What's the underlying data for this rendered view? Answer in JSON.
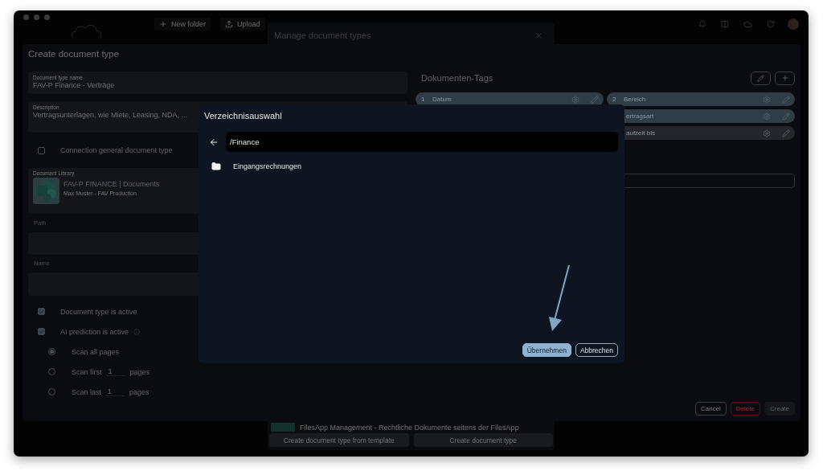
{
  "window": {
    "toolbar": [
      {
        "kind": "plus",
        "label": "New folder"
      },
      {
        "kind": "upload",
        "label": "Upload"
      }
    ]
  },
  "manage_modal": {
    "title": "Manage document types",
    "list_item": "FilesApp Management - Rechtliche Dokumente seitens der FilesApp",
    "buttons": [
      "Create document type from template",
      "Create document type"
    ]
  },
  "create_panel": {
    "title": "Create document type",
    "fields": [
      {
        "label": "Document type name",
        "value": "FAV-P Finance - Verträge"
      },
      {
        "label": "Description",
        "value": "Vertragsunterlagen, wie Miete, Leasing, NDA, ..."
      }
    ],
    "connection": {
      "label": "Connection general document type",
      "checked": false
    },
    "library": {
      "label": "Document Library",
      "name": "FAV-P FINANCE | Documents",
      "owner": "Max Muster - FAV Production"
    },
    "path": {
      "label": "Path"
    },
    "name": {
      "label": "Name"
    },
    "options": [
      {
        "label": "Document type is active",
        "checked": true,
        "info": false
      },
      {
        "label": "AI prediction is active",
        "checked": true,
        "info": true
      }
    ],
    "scan": [
      {
        "label": "Scan all pages",
        "selected": true
      },
      {
        "label": "Scan first",
        "count": "1",
        "unit": "pages",
        "selected": false
      },
      {
        "label": "Scan last",
        "count": "1",
        "unit": "pages",
        "selected": false
      }
    ],
    "tags": {
      "title": "Dokumenten-Tags",
      "rows": [
        {
          "left": {
            "number": "1",
            "label": "Datum",
            "highlighted": true
          },
          "right": {
            "number": "2",
            "label": "Bereich",
            "highlighted": true
          }
        },
        {
          "right": {
            "label": "ertragsart",
            "highlighted": true
          }
        },
        {
          "right": {
            "label": "aufzeit bis",
            "highlighted": false
          }
        }
      ]
    },
    "footer_buttons": [
      {
        "kind": "cancel",
        "label": "Cancel",
        "disabled": false
      },
      {
        "kind": "delete",
        "label": "Delete",
        "disabled": false
      },
      {
        "kind": "create",
        "label": "Create",
        "disabled": true
      }
    ]
  },
  "dialog": {
    "title": "Verzeichnisauswahl",
    "path": "/Finance",
    "folders": [
      "Eingangsrechnungen"
    ],
    "buttons": [
      {
        "kind": "primary",
        "label": "Übernehmen"
      },
      {
        "kind": "secondary",
        "label": "Abbrechen"
      }
    ]
  }
}
